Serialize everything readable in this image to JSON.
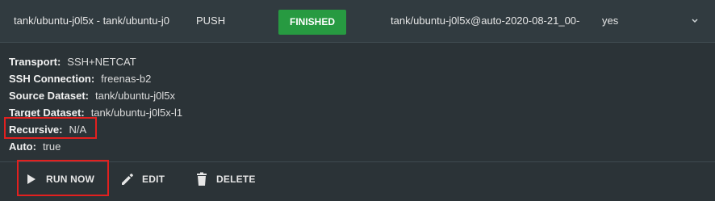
{
  "task_row": {
    "name": "tank/ubuntu-j0l5x - tank/ubuntu-j0",
    "direction": "PUSH",
    "state": "FINISHED",
    "last_snapshot": "tank/ubuntu-j0l5x@auto-2020-08-21_00-",
    "enabled": "yes",
    "expand_icon": "chevron-down-icon"
  },
  "details": {
    "transport": {
      "label": "Transport:",
      "value": "SSH+NETCAT"
    },
    "ssh_connection": {
      "label": "SSH Connection:",
      "value": "freenas-b2"
    },
    "source_dataset": {
      "label": "Source Dataset:",
      "value": "tank/ubuntu-j0l5x"
    },
    "target_dataset": {
      "label": "Target Dataset:",
      "value": "tank/ubuntu-j0l5x-l1"
    },
    "recursive": {
      "label": "Recursive:",
      "value": "N/A"
    },
    "auto": {
      "label": "Auto:",
      "value": "true"
    }
  },
  "actions": {
    "run_now": {
      "label": "RUN NOW",
      "icon": "play-icon"
    },
    "edit": {
      "label": "EDIT",
      "icon": "pencil-icon"
    },
    "delete": {
      "label": "DELETE",
      "icon": "trash-icon"
    }
  },
  "colors": {
    "finished_badge": "#279a41",
    "highlight": "#e2201f",
    "background": "#2b3337"
  }
}
